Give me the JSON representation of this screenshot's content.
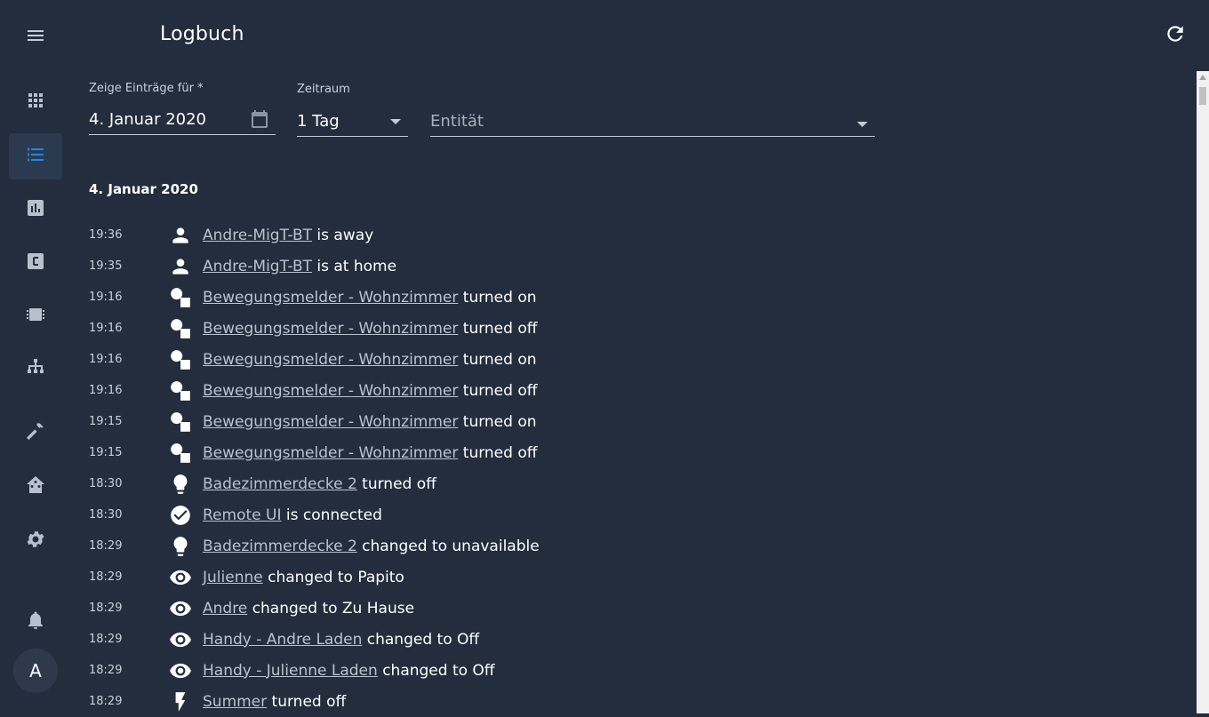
{
  "app": {
    "title": "Logbuch",
    "refresh_icon": "refresh-icon",
    "menu_icon": "hamburger-menu-icon"
  },
  "sidebar": {
    "items": [
      {
        "icon": "apps-grid-icon",
        "active": false
      },
      {
        "icon": "logbook-list-icon",
        "active": true
      },
      {
        "icon": "history-chart-icon",
        "active": false
      },
      {
        "icon": "hacs-icon",
        "active": false
      },
      {
        "icon": "chip-icon",
        "active": false
      },
      {
        "icon": "network-icon",
        "active": false
      },
      {
        "icon": "hammer-icon",
        "active": false
      },
      {
        "icon": "home-assistant-icon",
        "active": false
      },
      {
        "icon": "gear-icon",
        "active": false
      }
    ],
    "notifications_icon": "bell-icon",
    "avatar_letter": "A",
    "accent": "#1e88e5"
  },
  "filters": {
    "date_label": "Zeige Einträge für *",
    "date_value": "4. Januar 2020",
    "period_label": "Zeitraum",
    "period_value": "1 Tag",
    "entity_placeholder": "Entität"
  },
  "day_heading": "4. Januar 2020",
  "entries": [
    {
      "time": "19:36",
      "icon": "person",
      "entity": "Andre-MigT-BT",
      "message": "is away"
    },
    {
      "time": "19:35",
      "icon": "person",
      "entity": "Andre-MigT-BT",
      "message": "is at home"
    },
    {
      "time": "19:16",
      "icon": "shapes",
      "entity": "Bewegungsmelder - Wohnzimmer",
      "message": "turned on"
    },
    {
      "time": "19:16",
      "icon": "shapes",
      "entity": "Bewegungsmelder - Wohnzimmer",
      "message": "turned off"
    },
    {
      "time": "19:16",
      "icon": "shapes",
      "entity": "Bewegungsmelder - Wohnzimmer",
      "message": "turned on"
    },
    {
      "time": "19:16",
      "icon": "shapes",
      "entity": "Bewegungsmelder - Wohnzimmer",
      "message": "turned off"
    },
    {
      "time": "19:15",
      "icon": "shapes",
      "entity": "Bewegungsmelder - Wohnzimmer",
      "message": "turned on"
    },
    {
      "time": "19:15",
      "icon": "shapes",
      "entity": "Bewegungsmelder - Wohnzimmer",
      "message": "turned off"
    },
    {
      "time": "18:30",
      "icon": "bulb",
      "entity": "Badezimmerdecke 2",
      "message": "turned off"
    },
    {
      "time": "18:30",
      "icon": "check",
      "entity": "Remote UI",
      "message": "is connected"
    },
    {
      "time": "18:29",
      "icon": "bulb",
      "entity": "Badezimmerdecke 2",
      "message": "changed to unavailable"
    },
    {
      "time": "18:29",
      "icon": "eye",
      "entity": "Julienne",
      "message": "changed to Papito"
    },
    {
      "time": "18:29",
      "icon": "eye",
      "entity": "Andre",
      "message": "changed to Zu Hause"
    },
    {
      "time": "18:29",
      "icon": "eye",
      "entity": "Handy - Andre Laden",
      "message": "changed to Off"
    },
    {
      "time": "18:29",
      "icon": "eye",
      "entity": "Handy - Julienne Laden",
      "message": "changed to Off"
    },
    {
      "time": "18:29",
      "icon": "flash",
      "entity": "Summer",
      "message": "turned off"
    }
  ]
}
